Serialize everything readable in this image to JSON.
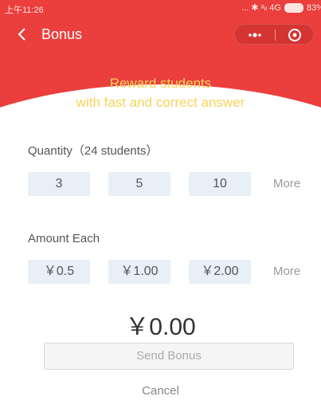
{
  "status_bar": {
    "time": "上午11:26",
    "signal_text": "... ✱ ᵃᵢₗ 4G",
    "battery_text": "83%"
  },
  "nav": {
    "title": "Bonus"
  },
  "headline": {
    "line1": "Reward students",
    "line2": "with fast and correct answer"
  },
  "quantity": {
    "label": "Quantity（24 students）",
    "options": [
      "3",
      "5",
      "10"
    ],
    "more": "More"
  },
  "amount": {
    "label": "Amount Each",
    "options": [
      "￥0.5",
      "￥1.00",
      "￥2.00"
    ],
    "more": "More"
  },
  "total": "￥0.00",
  "send_button": "Send Bonus",
  "cancel": "Cancel",
  "colors": {
    "header_red": "#ea3f3d",
    "headline_yellow": "#f7d35a",
    "option_bg": "#e8eff7"
  }
}
